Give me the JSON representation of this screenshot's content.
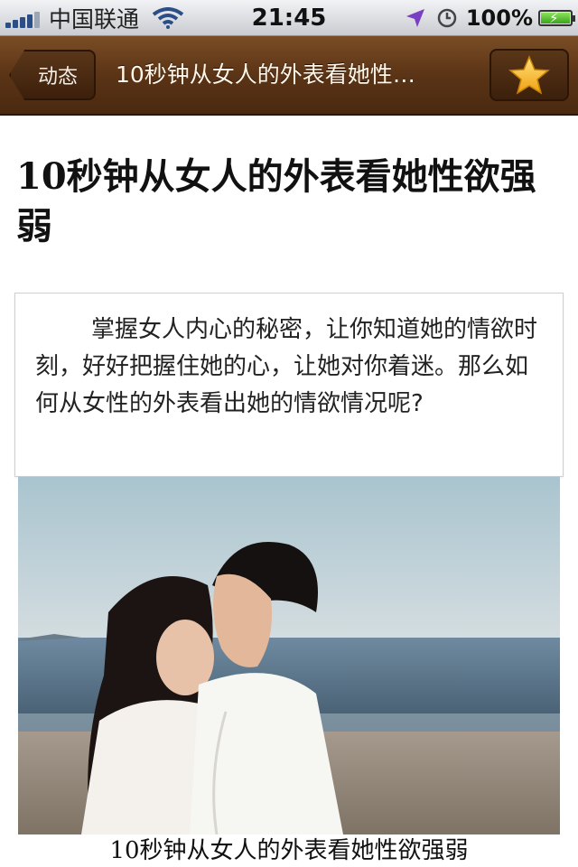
{
  "status_bar": {
    "carrier": "中国联通",
    "time": "21:45",
    "battery": "100%",
    "icons": [
      "signal-icon",
      "wifi-icon",
      "location-icon",
      "clock-icon",
      "battery-icon"
    ]
  },
  "nav": {
    "back_label": "动态",
    "title": "10秒钟从女人的外表看她性…",
    "favorite_icon": "star-icon"
  },
  "article": {
    "title": "10秒钟从女人的外表看她性欲强弱",
    "summary": "掌握女人内心的秘密，让你知道她的情欲时刻，好好把握住她的心，让她对你着迷。那么如何从女性的外表看出她的情欲情况呢?",
    "image_caption": "10秒钟从女人的外表看她性欲强弱"
  },
  "colors": {
    "nav_brown": "#5b3416",
    "star_gold": "#f6b81c"
  }
}
